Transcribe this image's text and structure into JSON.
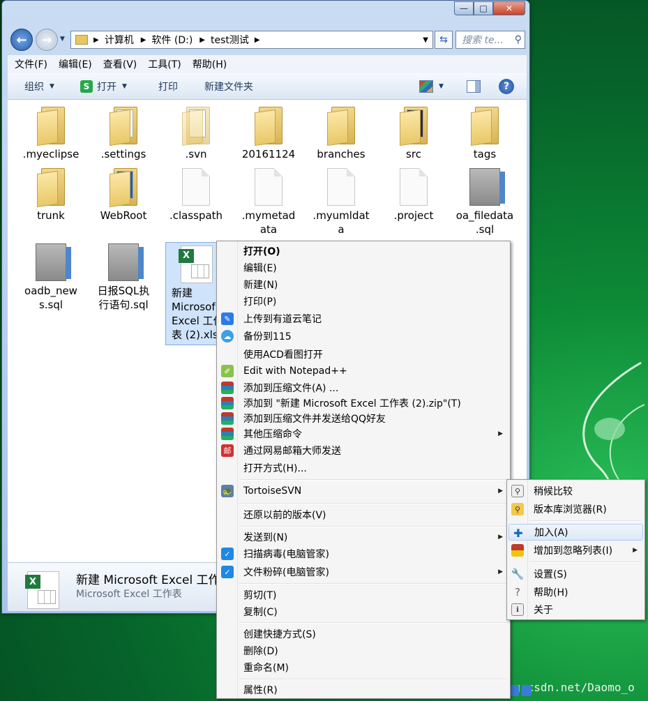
{
  "window": {
    "caption_min": "—",
    "caption_max": "□",
    "caption_close": "✕"
  },
  "nav": {
    "breadcrumbs": [
      "计算机",
      "软件 (D:)",
      "test测试"
    ],
    "search_placeholder": "搜索 te...",
    "back_glyph": "←",
    "forward_glyph": "→"
  },
  "menubar": [
    "文件(F)",
    "编辑(E)",
    "查看(V)",
    "工具(T)",
    "帮助(H)"
  ],
  "toolbar": {
    "organize": "组织",
    "open": "打开",
    "print": "打印",
    "new_folder": "新建文件夹",
    "help": "?"
  },
  "files": [
    {
      "name": ".myeclipse",
      "kind": "folder"
    },
    {
      "name": ".settings",
      "kind": "folder-paper"
    },
    {
      "name": ".svn",
      "kind": "folder-paper"
    },
    {
      "name": "20161124",
      "kind": "folder"
    },
    {
      "name": "branches",
      "kind": "folder"
    },
    {
      "name": "src",
      "kind": "folder-paper"
    },
    {
      "name": "tags",
      "kind": "folder"
    },
    {
      "name": "trunk",
      "kind": "folder"
    },
    {
      "name": "WebRoot",
      "kind": "folder-paper"
    },
    {
      "name": ".classpath",
      "kind": "blank"
    },
    {
      "name": ".mymetadata",
      "kind": "blank"
    },
    {
      "name": ".myumldata",
      "kind": "blank"
    },
    {
      "name": ".project",
      "kind": "blank"
    },
    {
      "name": "oa_filedata.sql",
      "kind": "sql"
    },
    {
      "name": "oadb_news.sql",
      "kind": "sql"
    },
    {
      "name": "日报SQL执行语句.sql",
      "kind": "sql"
    },
    {
      "name": "新建 Microsoft Excel 工作表 (2).xlsx",
      "kind": "excel",
      "selected": true
    }
  ],
  "file_labels": {
    "myeclipse": ".myeclipse",
    "settings": ".settings",
    "svn": ".svn",
    "d20161124": "20161124",
    "branches": "branches",
    "src": "src",
    "tags": "tags",
    "trunk": "trunk",
    "webroot": "WebRoot",
    "classpath": ".classpath",
    "mymetadata_1": ".mymetad",
    "mymetadata_2": "ata",
    "myumldata_1": ".myumldat",
    "myumldata_2": "a",
    "project": ".project",
    "oa_filedata_1": "oa_filedata",
    "oa_filedata_2": ".sql",
    "oadb_news_1": "oadb_new",
    "oadb_news_2": "s.sql",
    "ribao_1": "日报SQL执",
    "ribao_2": "行语句.sql",
    "excel_1": "新建",
    "excel_2": "Microsof",
    "excel_3": "Excel 工作",
    "excel_4": "表 (2).xlsx"
  },
  "details": {
    "name": "新建 Microsoft Excel 工作",
    "type": "Microsoft Excel 工作表"
  },
  "context_menu": {
    "open": "打开(O)",
    "edit": "编辑(E)",
    "new": "新建(N)",
    "print": "打印(P)",
    "youdao": "上传到有道云笔记",
    "backup115": "备份到115",
    "acd": "使用ACD看图打开",
    "notepad": "Edit with Notepad++",
    "add_archive": "添加到压缩文件(A) ...",
    "add_zip": "添加到 \"新建 Microsoft Excel 工作表 (2).zip\"(T)",
    "add_send_qq": "添加到压缩文件并发送给QQ好友",
    "other_compress": "其他压缩命令",
    "netease_mail": "通过网易邮箱大师发送",
    "open_with": "打开方式(H)...",
    "tortoise": "TortoiseSVN",
    "restore": "还原以前的版本(V)",
    "send_to": "发送到(N)",
    "scan_virus": "扫描病毒(电脑管家)",
    "shred": "文件粉碎(电脑管家)",
    "cut": "剪切(T)",
    "copy": "复制(C)",
    "shortcut": "创建快捷方式(S)",
    "delete": "删除(D)",
    "rename": "重命名(M)",
    "properties": "属性(R)"
  },
  "svn_submenu": {
    "diff_later": "稍候比较",
    "repo_browser": "版本库浏览器(R)",
    "add": "加入(A)",
    "ignore": "增加到忽略列表(I)",
    "settings": "设置(S)",
    "help": "帮助(H)",
    "about": "关于"
  },
  "watermark": "http://blog.csdn.net/Daomo_o",
  "colors": {
    "desktop_green": "#0d8a36",
    "menu_highlight": "#dce8f8",
    "excel_green": "#1f7a3e"
  }
}
